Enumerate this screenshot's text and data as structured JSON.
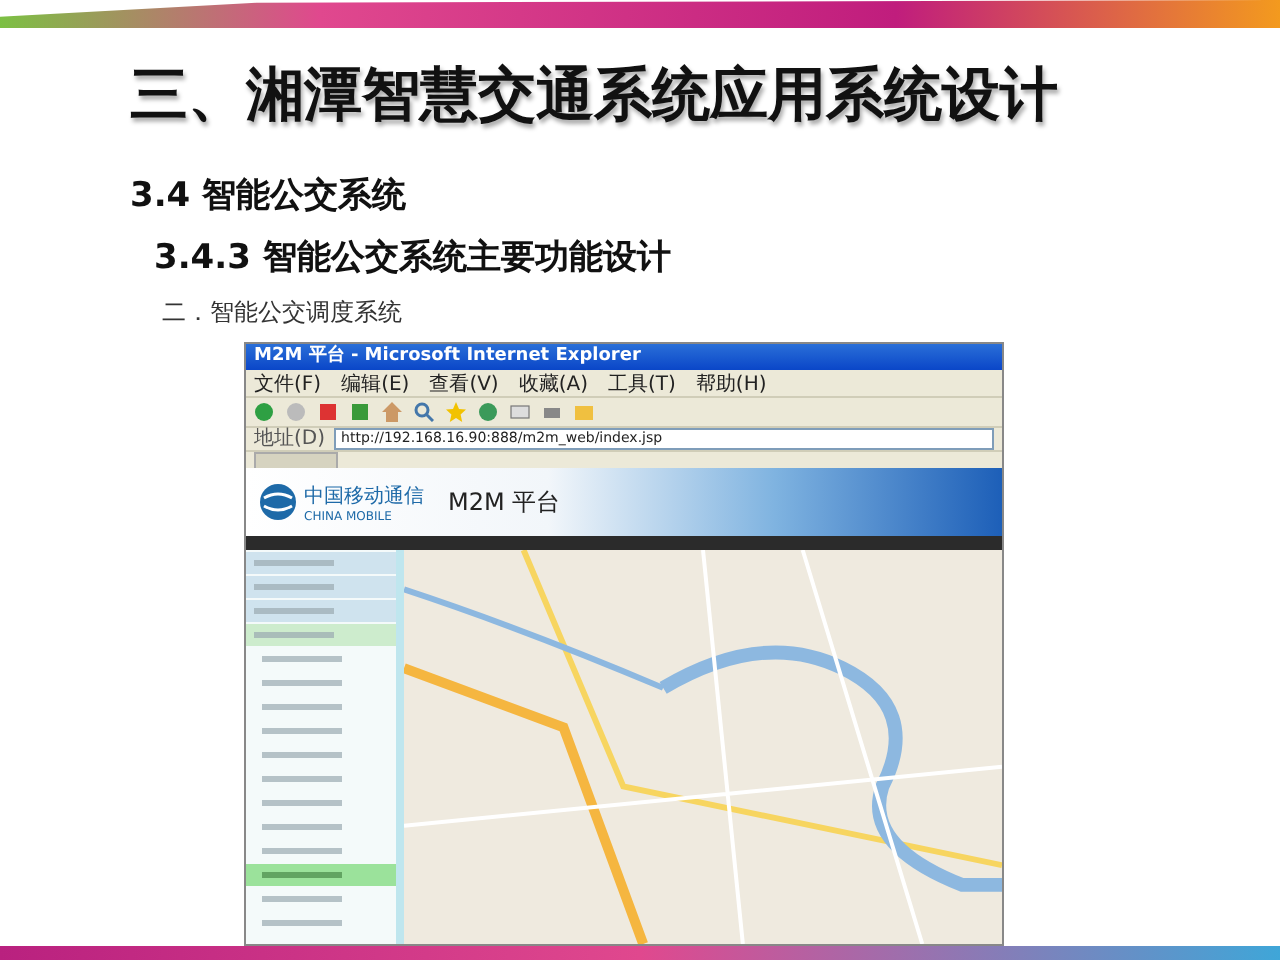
{
  "slide": {
    "title": "三、湘潭智慧交通系统应用系统设计",
    "heading": "3.4 智能公交系统",
    "subheading": "3.4.3 智能公交系统主要功能设计",
    "caption": "二．智能公交调度系统"
  },
  "browser": {
    "title": "M2M 平台 - Microsoft Internet Explorer",
    "menu": [
      "文件(F)",
      "编辑(E)",
      "查看(V)",
      "收藏(A)",
      "工具(T)",
      "帮助(H)"
    ],
    "address_label": "地址(D)",
    "address": "http://192.168.16.90:888/m2m_web/index.jsp",
    "logo": "中国移动通信",
    "logo_en": "CHINA MOBILE",
    "platform": "M2M 平台",
    "sidebar": [
      {
        "kind": "group",
        "selected": false
      },
      {
        "kind": "group",
        "selected": false
      },
      {
        "kind": "group",
        "selected": false
      },
      {
        "kind": "section",
        "selected": false
      },
      {
        "kind": "item",
        "selected": false
      },
      {
        "kind": "item",
        "selected": false
      },
      {
        "kind": "item",
        "selected": false
      },
      {
        "kind": "item",
        "selected": false
      },
      {
        "kind": "item",
        "selected": false
      },
      {
        "kind": "item",
        "selected": false
      },
      {
        "kind": "item",
        "selected": false
      },
      {
        "kind": "item",
        "selected": false
      },
      {
        "kind": "item",
        "selected": false
      },
      {
        "kind": "item",
        "selected": true
      },
      {
        "kind": "item",
        "selected": false
      },
      {
        "kind": "item",
        "selected": false
      }
    ]
  }
}
